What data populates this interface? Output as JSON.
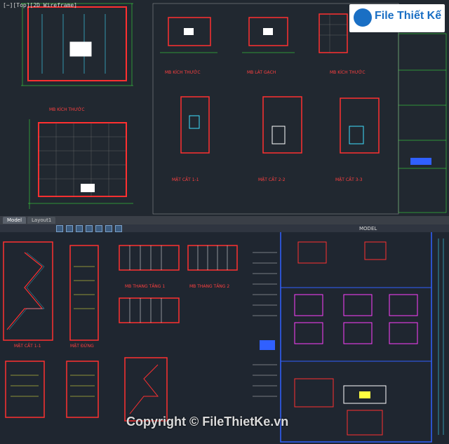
{
  "viewport": {
    "label": "[−][Top][2D Wireframe]"
  },
  "layout_tabs": [
    "Model",
    "Layout1"
  ],
  "model_tab_label": "MODEL",
  "logo": {
    "text": "File Thiết Kế"
  },
  "watermark": {
    "text": "Copyright © FileThietKe.vn"
  },
  "top_labels": {
    "plan1": "MB KÍCH THƯỚC",
    "plan2": "MB KÍCH THƯỚC",
    "plan3": "MB LÁT GẠCH",
    "plan4": "MB KÍCH THƯỚC",
    "sec1": "MẶT CẮT 1-1",
    "sec2": "MẶT CẮT 2-2",
    "sec3": "MẶT CẮT 3-3"
  },
  "bottom_labels": {
    "b1": "MB THANG TẦNG 1",
    "b2": "MB THANG TẦNG 2",
    "b3": "MẶT CẮT 1-1",
    "b4": "MẶT ĐỨNG"
  },
  "colors": {
    "red": "#ff3030",
    "green": "#40ff40",
    "cyan": "#40e0ff",
    "yellow": "#ffff40",
    "blue": "#3060ff",
    "magenta": "#ff40ff"
  }
}
